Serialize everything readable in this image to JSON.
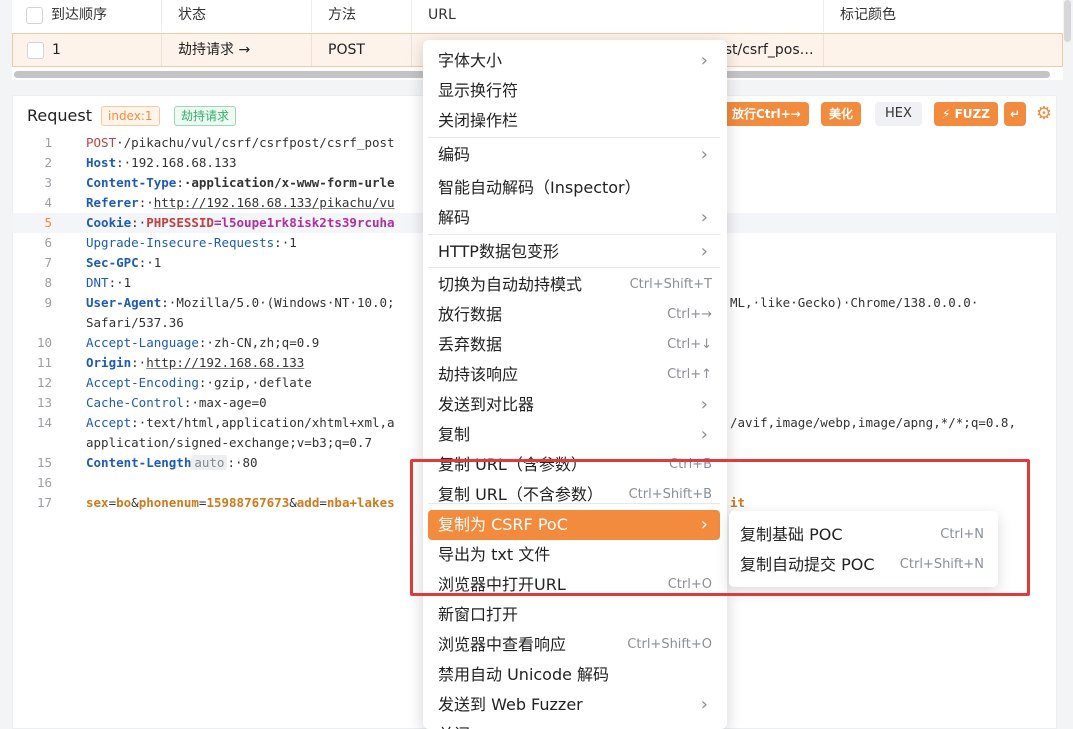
{
  "table": {
    "headers": [
      "到达顺序",
      "状态",
      "方法",
      "URL",
      "标记颜色"
    ],
    "row": {
      "index": "1",
      "status": "劫持请求 →",
      "method": "POST",
      "url": "/st/csrf_pos…",
      "color": ""
    }
  },
  "editor": {
    "title": "Request",
    "index_tag": "index:1",
    "status_tag": "劫持请求",
    "buttons": {
      "forward": "放行Ctrl+→",
      "beautify": "美化",
      "hex": "HEX",
      "fuzz": "⚡ FUZZ",
      "wrap": "↵"
    },
    "gear_icon": "gear-icon",
    "lines": [
      {
        "n": "1"
      },
      {
        "n": "2"
      },
      {
        "n": "3"
      },
      {
        "n": "4"
      },
      {
        "n": "5"
      },
      {
        "n": "6"
      },
      {
        "n": "7"
      },
      {
        "n": "8"
      },
      {
        "n": "9"
      },
      {
        "n": ""
      },
      {
        "n": "10"
      },
      {
        "n": "11"
      },
      {
        "n": "12"
      },
      {
        "n": "13"
      },
      {
        "n": "14"
      },
      {
        "n": ""
      },
      {
        "n": "15"
      },
      {
        "n": "16"
      },
      {
        "n": "17"
      }
    ],
    "code": {
      "l1_method": "POST",
      "l1_rest": "·/pikachu/vul/csrf/csrfpost/csrf_post",
      "l2_k": "Host",
      "l2_v": "·192.168.68.133",
      "l3_k": "Content-Type",
      "l3_v": "·application/x-www-form-urle",
      "l4_k": "Referer",
      "l4_v": "http://192.168.68.133/pikachu/vu",
      "l5_k": "Cookie",
      "l5_ck": "PHPSESSID",
      "l5_v": "=l5oupe1rk8isk2ts39rcuha",
      "l6_k": "Upgrade-Insecure-Requests",
      "l6_v": "·1",
      "l7_k": "Sec-GPC",
      "l7_v": "·1",
      "l8_k": "DNT",
      "l8_v": "·1",
      "l9_k": "User-Agent",
      "l9_v": "·Mozilla/5.0·(Windows·NT·10.0;",
      "l9_tail": "ML,·like·Gecko)·Chrome/138.0.0.0·",
      "l9b": "Safari/537.36",
      "l10_k": "Accept-Language",
      "l10_v": "·zh-CN,zh;q=0.9",
      "l11_k": "Origin",
      "l11_v": "http://192.168.68.133",
      "l12_k": "Accept-Encoding",
      "l12_v": "·gzip,·deflate",
      "l13_k": "Cache-Control",
      "l13_v": "·max-age=0",
      "l14_k": "Accept",
      "l14_v": "·text/html,application/xhtml+xml,a",
      "l14_tail": "/avif,image/webp,image/apng,*/*;q=0.8,",
      "l14b": "application/signed-exchange;v=b3;q=0.7",
      "l15_k": "Content-Length",
      "l15_auto": "auto",
      "l15_v": "·80",
      "l17_p1": "sex",
      "l17_v1": "bo",
      "l17_p2": "phonenum",
      "l17_v2": "15988767673",
      "l17_p3": "add",
      "l17_v3": "nba+lakes",
      "l17_tail": "it"
    }
  },
  "menu": {
    "items": [
      {
        "label": "字体大小",
        "sc": "",
        "arrow": true
      },
      {
        "label": "显示换行符",
        "sc": "",
        "arrow": false
      },
      {
        "label": "关闭操作栏",
        "sc": "",
        "arrow": false
      },
      {
        "label": "编码",
        "sc": "",
        "arrow": true
      },
      {
        "label": "智能自动解码（Inspector）",
        "sc": "",
        "arrow": false
      },
      {
        "label": "解码",
        "sc": "",
        "arrow": true
      },
      {
        "label": "HTTP数据包变形",
        "sc": "",
        "arrow": true
      },
      {
        "label": "切换为自动劫持模式",
        "sc": "Ctrl+Shift+T",
        "arrow": false
      },
      {
        "label": "放行数据",
        "sc": "Ctrl+→",
        "arrow": false
      },
      {
        "label": "丢弃数据",
        "sc": "Ctrl+↓",
        "arrow": false
      },
      {
        "label": "劫持该响应",
        "sc": "Ctrl+↑",
        "arrow": false
      },
      {
        "label": "发送到对比器",
        "sc": "",
        "arrow": true
      },
      {
        "label": "复制",
        "sc": "",
        "arrow": true
      },
      {
        "label": "复制 URL（含参数）",
        "sc": "Ctrl+B",
        "arrow": false
      },
      {
        "label": "复制 URL（不含参数）",
        "sc": "Ctrl+Shift+B",
        "arrow": false
      },
      {
        "label": "复制为 CSRF PoC",
        "sc": "",
        "arrow": true
      },
      {
        "label": "导出为 txt 文件",
        "sc": "",
        "arrow": false
      },
      {
        "label": "浏览器中打开URL",
        "sc": "Ctrl+O",
        "arrow": false
      },
      {
        "label": "新窗口打开",
        "sc": "",
        "arrow": false
      },
      {
        "label": "浏览器中查看响应",
        "sc": "Ctrl+Shift+O",
        "arrow": false
      },
      {
        "label": "禁用自动 Unicode 解码",
        "sc": "",
        "arrow": false
      },
      {
        "label": "发送到 Web Fuzzer",
        "sc": "",
        "arrow": true
      },
      {
        "label": "关闭",
        "sc": "",
        "arrow": false
      }
    ],
    "arrow_glyph": "›"
  },
  "submenu": {
    "items": [
      {
        "label": "复制基础 POC",
        "sc": "Ctrl+N"
      },
      {
        "label": "复制自动提交 POC",
        "sc": "Ctrl+Shift+N"
      }
    ]
  },
  "highlight_color": "#e03b3b",
  "accent_color": "#f28b3e"
}
